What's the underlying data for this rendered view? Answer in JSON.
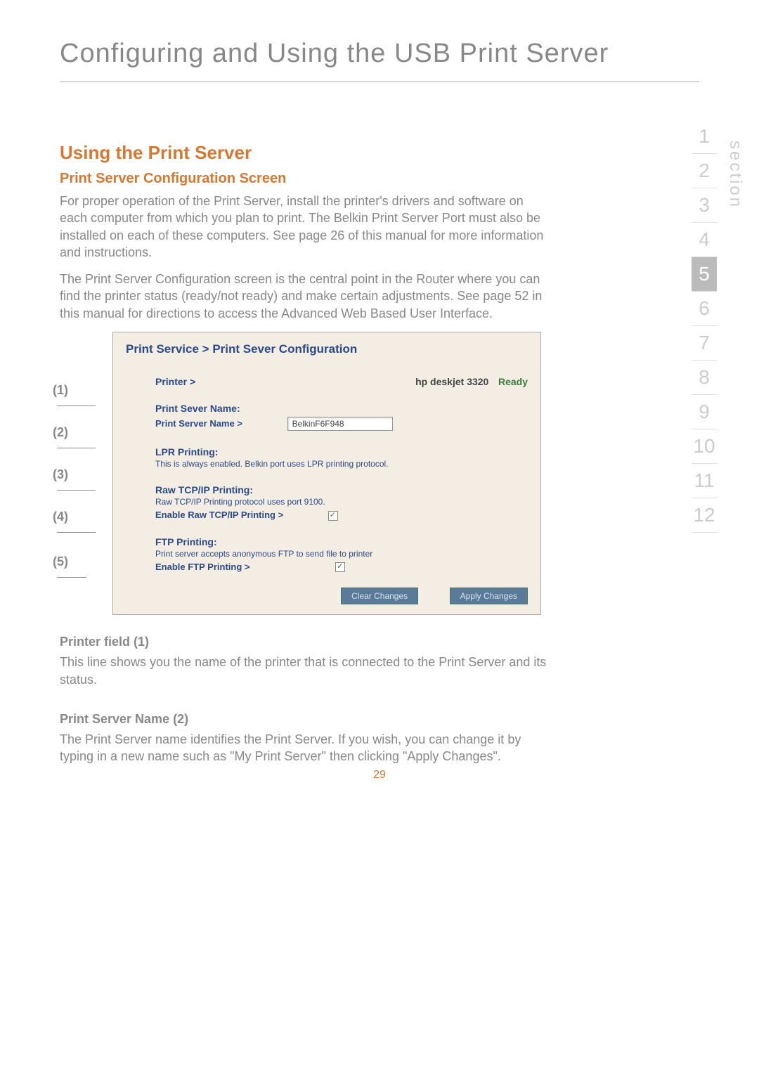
{
  "page": {
    "title": "Configuring and Using the USB Print Server",
    "number": "29"
  },
  "nav": {
    "items": [
      "1",
      "2",
      "3",
      "4",
      "5",
      "6",
      "7",
      "8",
      "9",
      "10",
      "11",
      "12"
    ],
    "active_index": 4,
    "label": "section"
  },
  "content": {
    "h2": "Using the Print Server",
    "h3": "Print Server Configuration Screen",
    "para1": "For proper operation of the Print Server, install the printer's drivers and software on each computer from which you plan to print. The Belkin Print Server Port must also be installed on each of these computers. See page 26 of this manual for more information and instructions.",
    "para2": "The Print Server Configuration screen is the central point in the Router where you can find the printer status (ready/not ready) and make certain adjustments. See page 52 in this manual for directions to access the Advanced Web Based User Interface.",
    "callouts": [
      "(1)",
      "(2)",
      "(3)",
      "(4)",
      "(5)"
    ],
    "printer_field_h": "Printer field (1)",
    "printer_field_p": "This line shows you the name of the printer that is connected to the Print Server and its status.",
    "server_name_h": "Print Server Name (2)",
    "server_name_p": "The Print Server name identifies the Print Server. If you wish, you can change it by typing in a new name such as \"My Print Server\" then clicking \"Apply Changes\"."
  },
  "screenshot": {
    "title": "Print Service > Print Sever Configuration",
    "printer_label": "Printer >",
    "printer_name": "hp deskjet 3320",
    "printer_status": "Ready",
    "name_heading": "Print Sever Name:",
    "name_label": "Print Server Name >",
    "name_value": "BelkinF6F948",
    "lpr_heading": "LPR Printing:",
    "lpr_desc": "This is always enabled. Belkin port uses LPR printing protocol.",
    "raw_heading": "Raw TCP/IP Printing:",
    "raw_desc": "Raw TCP/IP Printing protocol uses port 9100.",
    "raw_enable": "Enable Raw TCP/IP Printing >",
    "ftp_heading": "FTP Printing:",
    "ftp_desc": "Print server accepts anonymous FTP to send file to printer",
    "ftp_enable": "Enable FTP Printing >",
    "btn_clear": "Clear Changes",
    "btn_apply": "Apply Changes"
  }
}
